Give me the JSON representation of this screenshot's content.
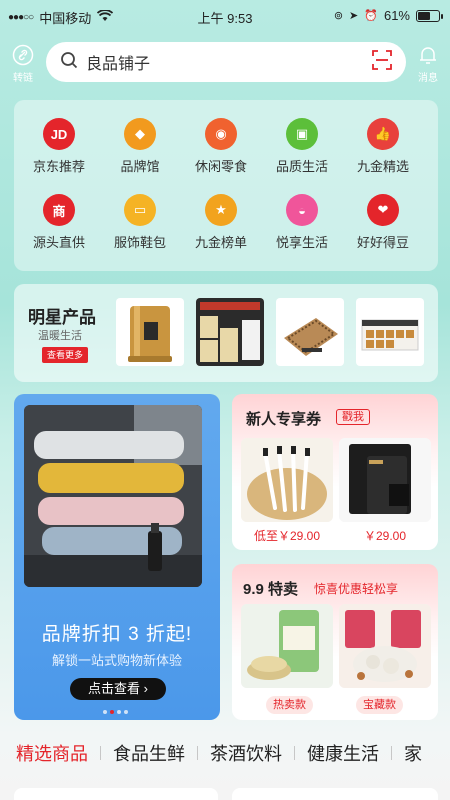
{
  "status_bar": {
    "carrier": "中国移动",
    "time": "上午 9:53",
    "battery": "61%"
  },
  "header": {
    "left_button_label": "转链",
    "search_text": "良品铺子",
    "right_button_label": "消息"
  },
  "categories": [
    {
      "label": "京东推荐",
      "icon": "jd-icon",
      "color": "#e4252b",
      "glyph": "JD"
    },
    {
      "label": "品牌馆",
      "icon": "diamond-icon",
      "color": "#f29a1e",
      "glyph": "◆"
    },
    {
      "label": "休闲零食",
      "icon": "lollipop-icon",
      "color": "#f0622f",
      "glyph": "◉"
    },
    {
      "label": "品质生活",
      "icon": "cube-icon",
      "color": "#5cbf3a",
      "glyph": "▣"
    },
    {
      "label": "九金精选",
      "icon": "thumbs-up-icon",
      "color": "#e8413c",
      "glyph": "👍"
    },
    {
      "label": "源头直供",
      "icon": "source-icon",
      "color": "#e4252b",
      "glyph": "商"
    },
    {
      "label": "服饰鞋包",
      "icon": "bag-icon",
      "color": "#f5b324",
      "glyph": "▭"
    },
    {
      "label": "九金榜单",
      "icon": "ranking-icon",
      "color": "#f2a31e",
      "glyph": "★"
    },
    {
      "label": "悦享生活",
      "icon": "shopping-bag-icon",
      "color": "#f0559a",
      "glyph": "◒"
    },
    {
      "label": "好好得豆",
      "icon": "bean-icon",
      "color": "#e4252b",
      "glyph": "❤"
    }
  ],
  "star_products": {
    "title": "明星产品",
    "subtitle": "温暖生活",
    "button_label": "查看更多"
  },
  "brand_banner": {
    "title": "品牌折扣 3 折起!",
    "subtitle": "解锁一站式购物新体验",
    "button_label": "点击查看"
  },
  "coupon_card": {
    "title": "新人专享券",
    "badge": "戳我",
    "prices": [
      "低至￥29.00",
      "￥29.00"
    ]
  },
  "deal_card": {
    "title": "9.9 特卖",
    "subtitle": "惊喜优惠轻松享",
    "tags": [
      "热卖款",
      "宝藏款"
    ]
  },
  "tabs": [
    "精选商品",
    "食品生鲜",
    "茶酒饮料",
    "健康生活",
    "家"
  ],
  "colors": {
    "accent": "#e4252b",
    "theme": "#a6e4da",
    "banner": "#4b98ea"
  }
}
